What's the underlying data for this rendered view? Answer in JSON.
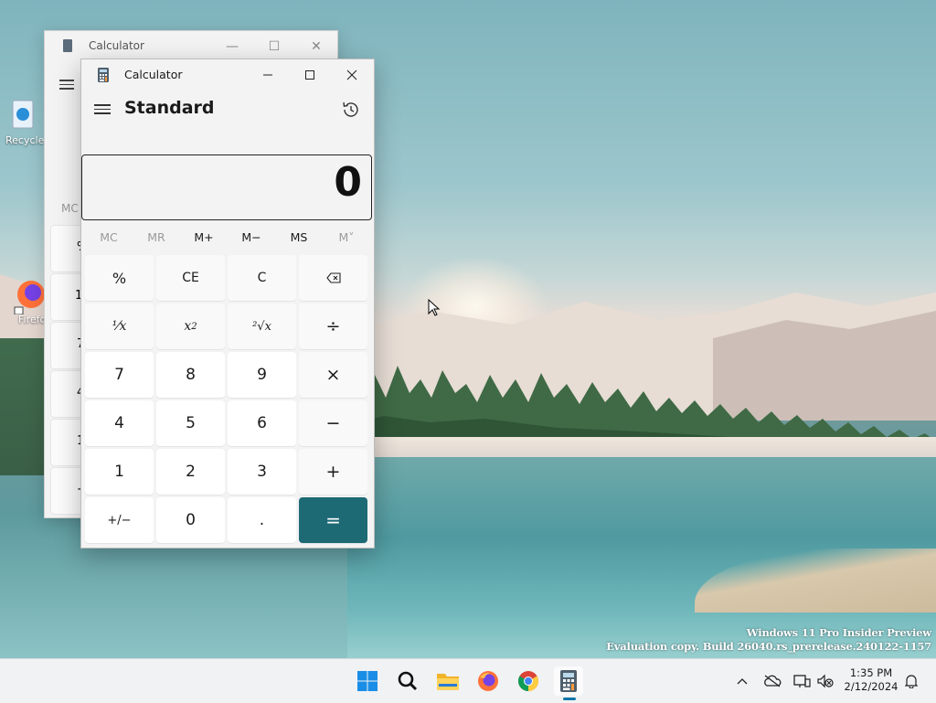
{
  "desktop": {
    "icons": [
      {
        "label": "Recycle"
      },
      {
        "label": "Firefo"
      }
    ],
    "watermark": {
      "line1": "Windows 11 Pro Insider Preview",
      "line2": "Evaluation copy. Build 26040.rs_prerelease.240122-1157"
    }
  },
  "back_window": {
    "title": "Calculator",
    "visible_memory_label": "MC",
    "visible_edge_glyphs": [
      "%",
      "1/",
      "7",
      "4",
      "1",
      "+"
    ]
  },
  "calculator": {
    "title": "Calculator",
    "mode": "Standard",
    "display": "0",
    "memory": [
      {
        "label": "MC",
        "enabled": false
      },
      {
        "label": "MR",
        "enabled": false
      },
      {
        "label": "M+",
        "enabled": true
      },
      {
        "label": "M−",
        "enabled": true
      },
      {
        "label": "MS",
        "enabled": true
      },
      {
        "label": "M˅",
        "enabled": false
      }
    ],
    "keys": {
      "percent": "%",
      "ce": "CE",
      "clear": "C",
      "backspace": "⌫",
      "reciprocal": "⅟x",
      "square": "x",
      "square_sup": "2",
      "sqrt": "²√x",
      "divide": "÷",
      "seven": "7",
      "eight": "8",
      "nine": "9",
      "multiply": "×",
      "four": "4",
      "five": "5",
      "six": "6",
      "minus": "−",
      "one": "1",
      "two": "2",
      "three": "3",
      "plus": "+",
      "negate": "+/−",
      "zero": "0",
      "decimal": ".",
      "equals": "="
    },
    "accent_color": "#1d6a75"
  },
  "taskbar": {
    "apps": [
      "start-icon",
      "search-icon",
      "file-explorer-icon",
      "firefox-icon",
      "chrome-icon",
      "calculator-icon"
    ],
    "clock": {
      "time": "1:35 PM",
      "date": "2/12/2024"
    }
  }
}
